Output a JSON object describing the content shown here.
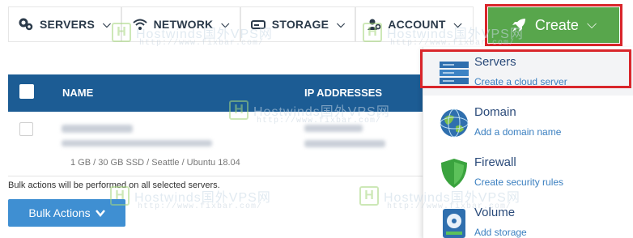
{
  "nav": {
    "servers_label": "SERVERS",
    "network_label": "NETWORK",
    "storage_label": "STORAGE",
    "account_label": "ACCOUNT",
    "create_label": "Create",
    "caret": "⌵"
  },
  "table": {
    "columns": [
      "NAME",
      "IP ADDRESSES"
    ],
    "server_meta": "1 GB / 30 GB SSD / Seattle / Ubuntu 18.04"
  },
  "bulk": {
    "note": "Bulk actions will be performed on all selected servers.",
    "button_label": "Bulk Actions"
  },
  "dropdown": {
    "items": [
      {
        "title": "Servers",
        "subtitle": "Create a cloud server",
        "icon": "server-icon"
      },
      {
        "title": "Domain",
        "subtitle": "Add a domain name",
        "icon": "globe-icon"
      },
      {
        "title": "Firewall",
        "subtitle": "Create security rules",
        "icon": "shield-icon"
      },
      {
        "title": "Volume",
        "subtitle": "Add storage",
        "icon": "disk-icon"
      }
    ]
  },
  "watermark": {
    "text": "Hostwinds国外VPS网",
    "url": "http://www.fixbar.com/",
    "badge": "H"
  },
  "colors": {
    "header_blue": "#1c5c94",
    "create_green": "#58a64c",
    "highlight_red": "#d9262b",
    "bulk_blue": "#3f8fd2"
  }
}
